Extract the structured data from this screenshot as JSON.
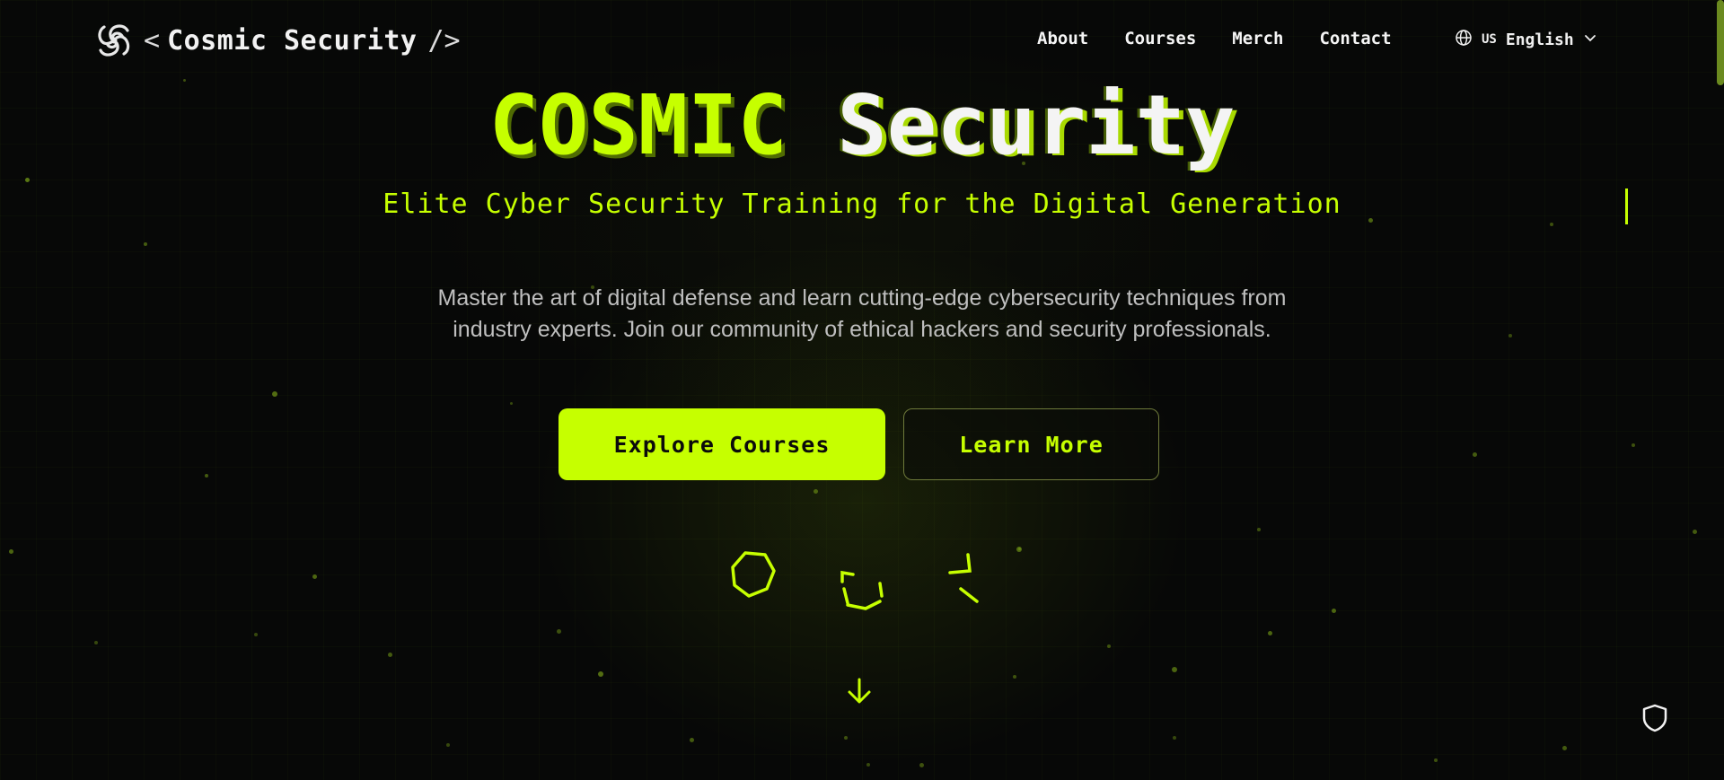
{
  "brand": {
    "name": "Cosmic Security",
    "open_bracket": "<",
    "close_bracket": "/>"
  },
  "nav": {
    "items": [
      {
        "label": "About"
      },
      {
        "label": "Courses"
      },
      {
        "label": "Merch"
      },
      {
        "label": "Contact"
      }
    ]
  },
  "language": {
    "flag": "US",
    "label": "English",
    "icon": "globe-icon"
  },
  "hero": {
    "title_part1": "COSMIC",
    "title_part2": "Security",
    "tagline": "Elite Cyber Security Training for the Digital Generation",
    "description": "Master the art of digital defense and learn cutting-edge cybersecurity techniques from industry experts. Join our community of ethical hackers and security professionals.",
    "primary_button": "Explore Courses",
    "secondary_button": "Learn More"
  },
  "decorations": [
    "shield-outline-icon",
    "focus-brackets-icon",
    "broken-shapes-icon"
  ],
  "scroll_indicator": "arrow-down-icon",
  "floating_action": "shield-icon",
  "colors": {
    "accent": "#c6ff00",
    "background": "#070807",
    "text": "#f4f4f4",
    "muted": "#bfbfbf"
  }
}
